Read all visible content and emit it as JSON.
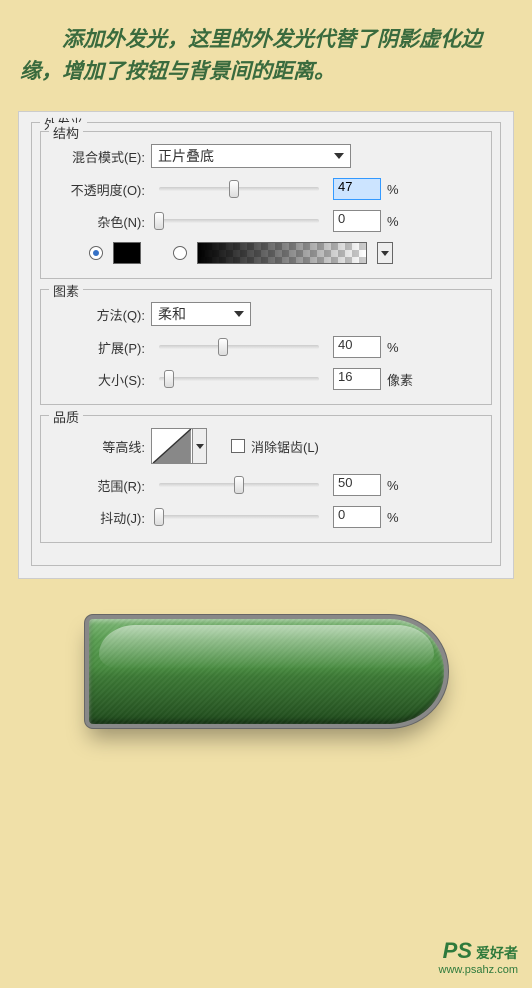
{
  "description": "添加外发光，这里的外发光代替了阴影虚化边缘，增加了按钮与背景间的距离。",
  "dialog": {
    "title": "外发光",
    "structure": {
      "legend": "结构",
      "blend_mode": {
        "label": "混合模式(E):",
        "value": "正片叠底"
      },
      "opacity": {
        "label": "不透明度(O):",
        "value": "47",
        "unit": "%"
      },
      "noise": {
        "label": "杂色(N):",
        "value": "0",
        "unit": "%"
      }
    },
    "elements": {
      "legend": "图素",
      "technique": {
        "label": "方法(Q):",
        "value": "柔和"
      },
      "spread": {
        "label": "扩展(P):",
        "value": "40",
        "unit": "%"
      },
      "size": {
        "label": "大小(S):",
        "value": "16",
        "unit": "像素"
      }
    },
    "quality": {
      "legend": "品质",
      "contour": {
        "label": "等高线:"
      },
      "antialias": {
        "label": "消除锯齿(L)"
      },
      "range": {
        "label": "范围(R):",
        "value": "50",
        "unit": "%"
      },
      "jitter": {
        "label": "抖动(J):",
        "value": "0",
        "unit": "%"
      }
    }
  },
  "watermark": {
    "logo": "PS",
    "name": "爱好者",
    "url": "www.psahz.com"
  }
}
